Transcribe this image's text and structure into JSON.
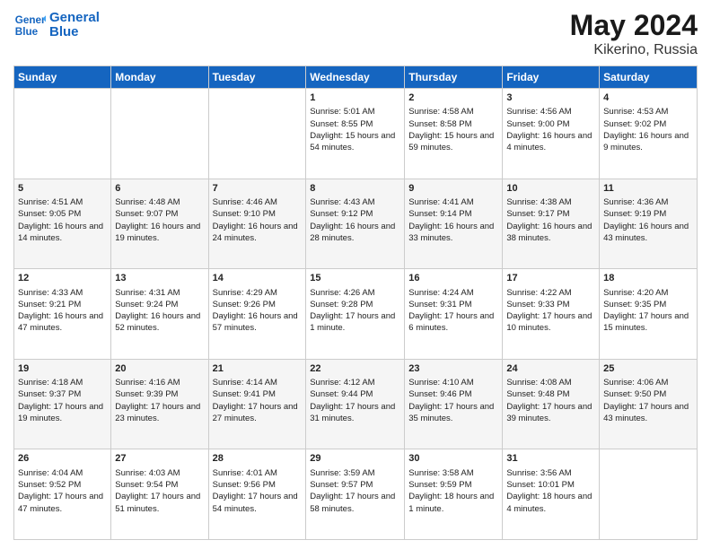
{
  "header": {
    "logo_line1": "General",
    "logo_line2": "Blue",
    "month_year": "May 2024",
    "location": "Kikerino, Russia"
  },
  "days_of_week": [
    "Sunday",
    "Monday",
    "Tuesday",
    "Wednesday",
    "Thursday",
    "Friday",
    "Saturday"
  ],
  "weeks": [
    [
      {
        "day": "",
        "content": ""
      },
      {
        "day": "",
        "content": ""
      },
      {
        "day": "",
        "content": ""
      },
      {
        "day": "1",
        "content": "Sunrise: 5:01 AM\nSunset: 8:55 PM\nDaylight: 15 hours and 54 minutes."
      },
      {
        "day": "2",
        "content": "Sunrise: 4:58 AM\nSunset: 8:58 PM\nDaylight: 15 hours and 59 minutes."
      },
      {
        "day": "3",
        "content": "Sunrise: 4:56 AM\nSunset: 9:00 PM\nDaylight: 16 hours and 4 minutes."
      },
      {
        "day": "4",
        "content": "Sunrise: 4:53 AM\nSunset: 9:02 PM\nDaylight: 16 hours and 9 minutes."
      }
    ],
    [
      {
        "day": "5",
        "content": "Sunrise: 4:51 AM\nSunset: 9:05 PM\nDaylight: 16 hours and 14 minutes."
      },
      {
        "day": "6",
        "content": "Sunrise: 4:48 AM\nSunset: 9:07 PM\nDaylight: 16 hours and 19 minutes."
      },
      {
        "day": "7",
        "content": "Sunrise: 4:46 AM\nSunset: 9:10 PM\nDaylight: 16 hours and 24 minutes."
      },
      {
        "day": "8",
        "content": "Sunrise: 4:43 AM\nSunset: 9:12 PM\nDaylight: 16 hours and 28 minutes."
      },
      {
        "day": "9",
        "content": "Sunrise: 4:41 AM\nSunset: 9:14 PM\nDaylight: 16 hours and 33 minutes."
      },
      {
        "day": "10",
        "content": "Sunrise: 4:38 AM\nSunset: 9:17 PM\nDaylight: 16 hours and 38 minutes."
      },
      {
        "day": "11",
        "content": "Sunrise: 4:36 AM\nSunset: 9:19 PM\nDaylight: 16 hours and 43 minutes."
      }
    ],
    [
      {
        "day": "12",
        "content": "Sunrise: 4:33 AM\nSunset: 9:21 PM\nDaylight: 16 hours and 47 minutes."
      },
      {
        "day": "13",
        "content": "Sunrise: 4:31 AM\nSunset: 9:24 PM\nDaylight: 16 hours and 52 minutes."
      },
      {
        "day": "14",
        "content": "Sunrise: 4:29 AM\nSunset: 9:26 PM\nDaylight: 16 hours and 57 minutes."
      },
      {
        "day": "15",
        "content": "Sunrise: 4:26 AM\nSunset: 9:28 PM\nDaylight: 17 hours and 1 minute."
      },
      {
        "day": "16",
        "content": "Sunrise: 4:24 AM\nSunset: 9:31 PM\nDaylight: 17 hours and 6 minutes."
      },
      {
        "day": "17",
        "content": "Sunrise: 4:22 AM\nSunset: 9:33 PM\nDaylight: 17 hours and 10 minutes."
      },
      {
        "day": "18",
        "content": "Sunrise: 4:20 AM\nSunset: 9:35 PM\nDaylight: 17 hours and 15 minutes."
      }
    ],
    [
      {
        "day": "19",
        "content": "Sunrise: 4:18 AM\nSunset: 9:37 PM\nDaylight: 17 hours and 19 minutes."
      },
      {
        "day": "20",
        "content": "Sunrise: 4:16 AM\nSunset: 9:39 PM\nDaylight: 17 hours and 23 minutes."
      },
      {
        "day": "21",
        "content": "Sunrise: 4:14 AM\nSunset: 9:41 PM\nDaylight: 17 hours and 27 minutes."
      },
      {
        "day": "22",
        "content": "Sunrise: 4:12 AM\nSunset: 9:44 PM\nDaylight: 17 hours and 31 minutes."
      },
      {
        "day": "23",
        "content": "Sunrise: 4:10 AM\nSunset: 9:46 PM\nDaylight: 17 hours and 35 minutes."
      },
      {
        "day": "24",
        "content": "Sunrise: 4:08 AM\nSunset: 9:48 PM\nDaylight: 17 hours and 39 minutes."
      },
      {
        "day": "25",
        "content": "Sunrise: 4:06 AM\nSunset: 9:50 PM\nDaylight: 17 hours and 43 minutes."
      }
    ],
    [
      {
        "day": "26",
        "content": "Sunrise: 4:04 AM\nSunset: 9:52 PM\nDaylight: 17 hours and 47 minutes."
      },
      {
        "day": "27",
        "content": "Sunrise: 4:03 AM\nSunset: 9:54 PM\nDaylight: 17 hours and 51 minutes."
      },
      {
        "day": "28",
        "content": "Sunrise: 4:01 AM\nSunset: 9:56 PM\nDaylight: 17 hours and 54 minutes."
      },
      {
        "day": "29",
        "content": "Sunrise: 3:59 AM\nSunset: 9:57 PM\nDaylight: 17 hours and 58 minutes."
      },
      {
        "day": "30",
        "content": "Sunrise: 3:58 AM\nSunset: 9:59 PM\nDaylight: 18 hours and 1 minute."
      },
      {
        "day": "31",
        "content": "Sunrise: 3:56 AM\nSunset: 10:01 PM\nDaylight: 18 hours and 4 minutes."
      },
      {
        "day": "",
        "content": ""
      }
    ]
  ]
}
